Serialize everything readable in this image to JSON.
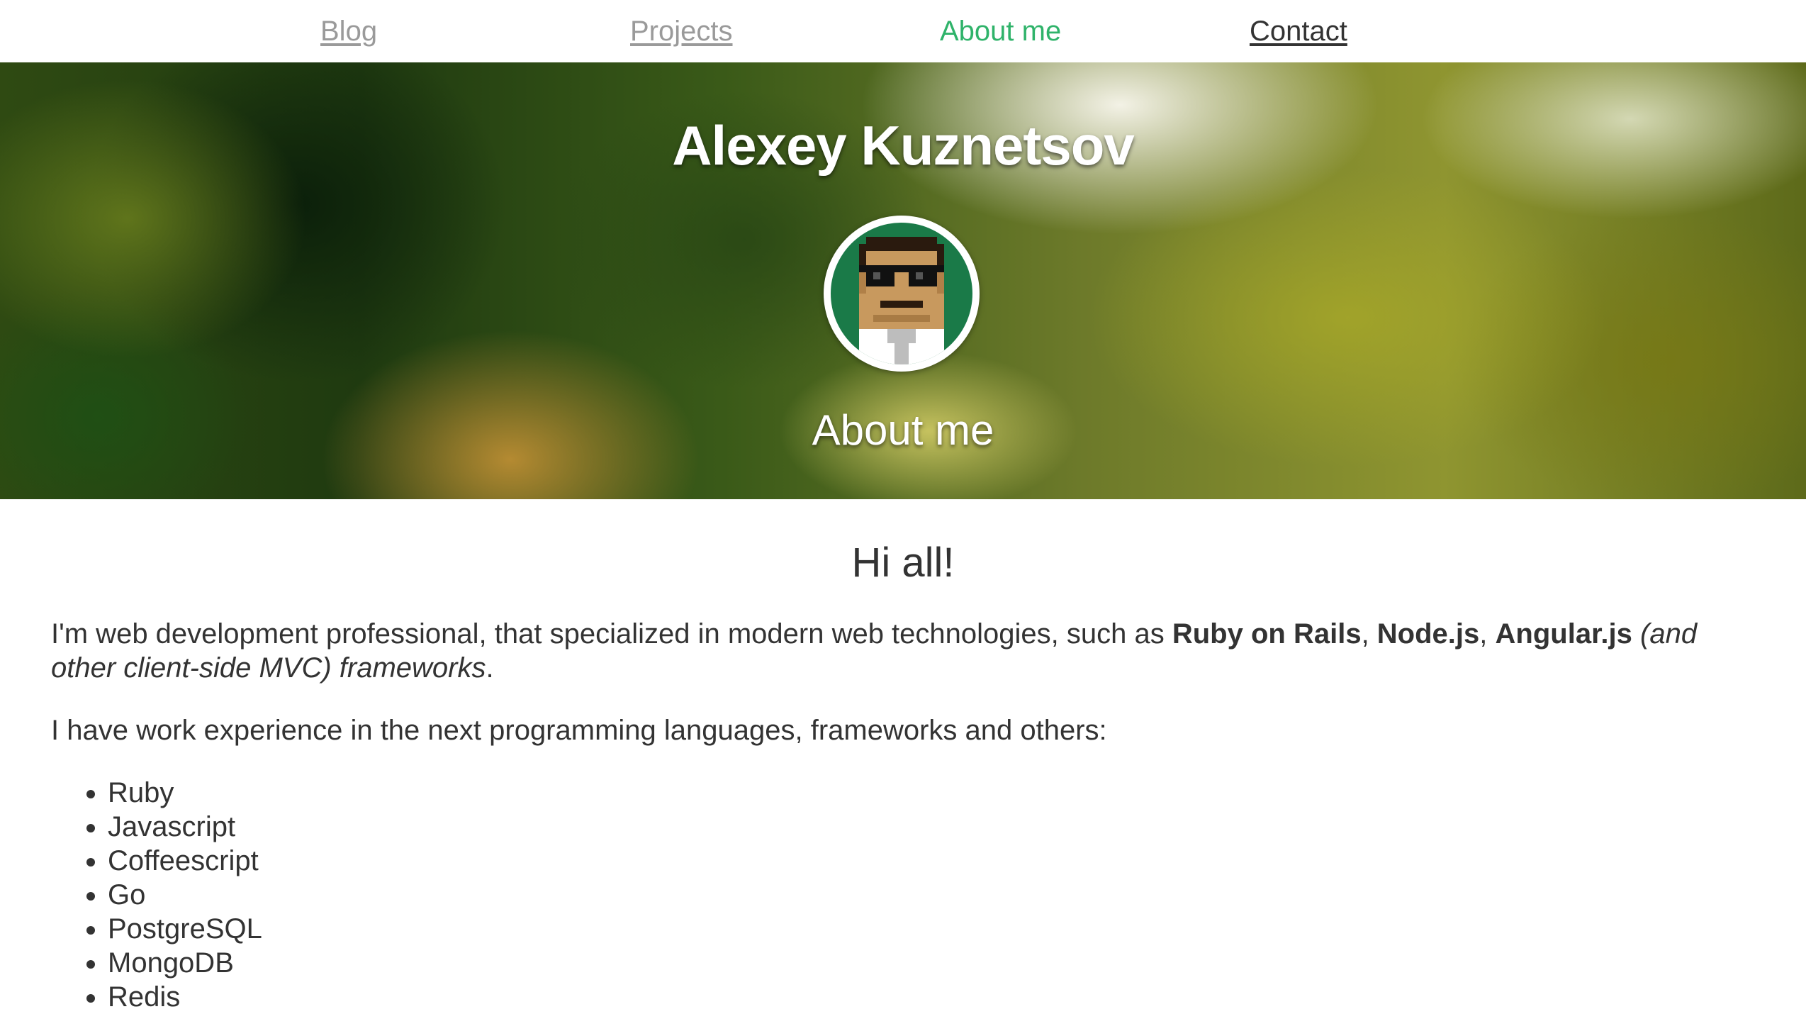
{
  "nav": {
    "items": [
      {
        "label": "Blog"
      },
      {
        "label": "Projects"
      },
      {
        "label": "About me"
      },
      {
        "label": "Contact"
      }
    ]
  },
  "hero": {
    "title": "Alexey Kuznetsov",
    "subtitle": "About me"
  },
  "content": {
    "heading": "Hi all!",
    "intro": {
      "text_before": "I'm web development professional, that specialized in modern web technologies, such as ",
      "tech1": "Ruby on Rails",
      "sep1": ", ",
      "tech2": "Node.js",
      "sep2": ", ",
      "tech3": "Angular.js",
      "italic": " (and other client-side MVC) frameworks",
      "period": "."
    },
    "experience_text": "I have work experience in the next programming languages, frameworks and others:",
    "languages": [
      "Ruby",
      "Javascript",
      "Coffeescript",
      "Go",
      "PostgreSQL",
      "MongoDB",
      "Redis"
    ]
  },
  "colors": {
    "accent": "#2fb36a",
    "text": "#333333",
    "nav_inactive": "#9a9a9a"
  }
}
